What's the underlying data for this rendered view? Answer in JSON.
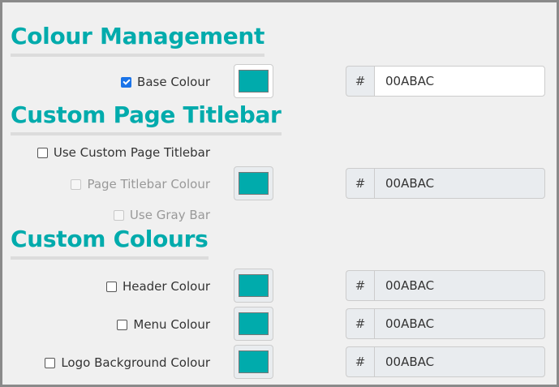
{
  "sections": {
    "colour_management": "Colour Management",
    "custom_page_titlebar": "Custom Page Titlebar",
    "custom_colours": "Custom Colours"
  },
  "base_colour": {
    "label": "Base Colour",
    "checked": true,
    "hash": "#",
    "value": "00ABAC"
  },
  "use_custom_titlebar": {
    "label": "Use Custom Page Titlebar",
    "checked": false
  },
  "page_titlebar_colour": {
    "label": "Page Titlebar Colour",
    "hash": "#",
    "value": "00ABAC",
    "disabled": true
  },
  "use_gray_bar": {
    "label": "Use Gray Bar",
    "disabled": true
  },
  "header_colour": {
    "label": "Header Colour",
    "hash": "#",
    "value": "00ABAC"
  },
  "menu_colour": {
    "label": "Menu Colour",
    "hash": "#",
    "value": "00ABAC"
  },
  "logo_background_colour": {
    "label": "Logo Background Colour",
    "hash": "#",
    "value": "00ABAC"
  },
  "colors": {
    "accent": "#00abac",
    "swatch": "#00abac"
  }
}
